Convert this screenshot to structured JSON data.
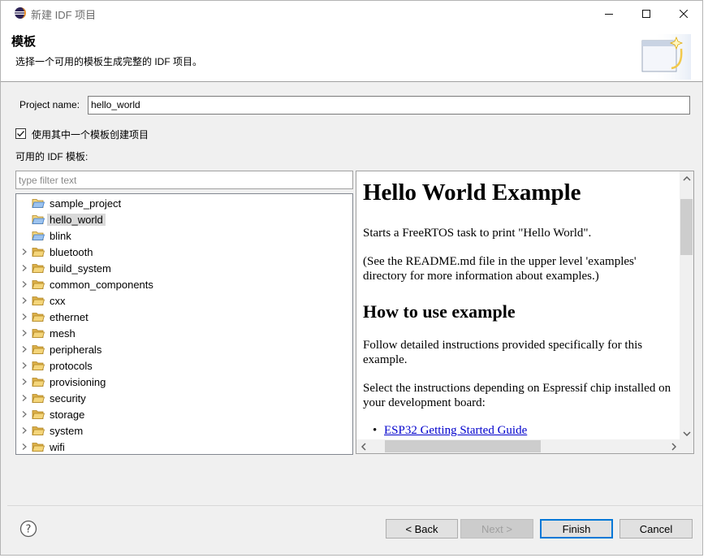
{
  "window": {
    "title": "新建 IDF 项目"
  },
  "header": {
    "title": "模板",
    "description": "选择一个可用的模板生成完整的 IDF 项目。"
  },
  "form": {
    "project_name_label": "Project name:",
    "project_name_value": "hello_world",
    "use_template_label": "使用其中一个模板创建项目",
    "use_template_checked": true,
    "templates_label": "可用的 IDF 模板:",
    "filter_placeholder": "type filter text"
  },
  "tree": {
    "selected": "hello_world",
    "items": [
      {
        "label": "sample_project",
        "kind": "template"
      },
      {
        "label": "hello_world",
        "kind": "template"
      },
      {
        "label": "blink",
        "kind": "template"
      },
      {
        "label": "bluetooth",
        "kind": "folder"
      },
      {
        "label": "build_system",
        "kind": "folder"
      },
      {
        "label": "common_components",
        "kind": "folder"
      },
      {
        "label": "cxx",
        "kind": "folder"
      },
      {
        "label": "ethernet",
        "kind": "folder"
      },
      {
        "label": "mesh",
        "kind": "folder"
      },
      {
        "label": "peripherals",
        "kind": "folder"
      },
      {
        "label": "protocols",
        "kind": "folder"
      },
      {
        "label": "provisioning",
        "kind": "folder"
      },
      {
        "label": "security",
        "kind": "folder"
      },
      {
        "label": "storage",
        "kind": "folder"
      },
      {
        "label": "system",
        "kind": "folder"
      },
      {
        "label": "wifi",
        "kind": "folder"
      }
    ]
  },
  "preview": {
    "h1": "Hello World Example",
    "p1": "Starts a FreeRTOS task to print \"Hello World\".",
    "p2": "(See the README.md file in the upper level 'examples' directory for more information about examples.)",
    "h2": "How to use example",
    "p3": "Follow detailed instructions provided specifically for this example.",
    "p4": "Select the instructions depending on Espressif chip installed on your development board:",
    "link1": "ESP32 Getting Started Guide"
  },
  "buttons": {
    "back": "< Back",
    "next": "Next >",
    "finish": "Finish",
    "cancel": "Cancel"
  },
  "colors": {
    "accent": "#0078d7",
    "folder": "#dcb04a",
    "link": "#0000cc"
  }
}
